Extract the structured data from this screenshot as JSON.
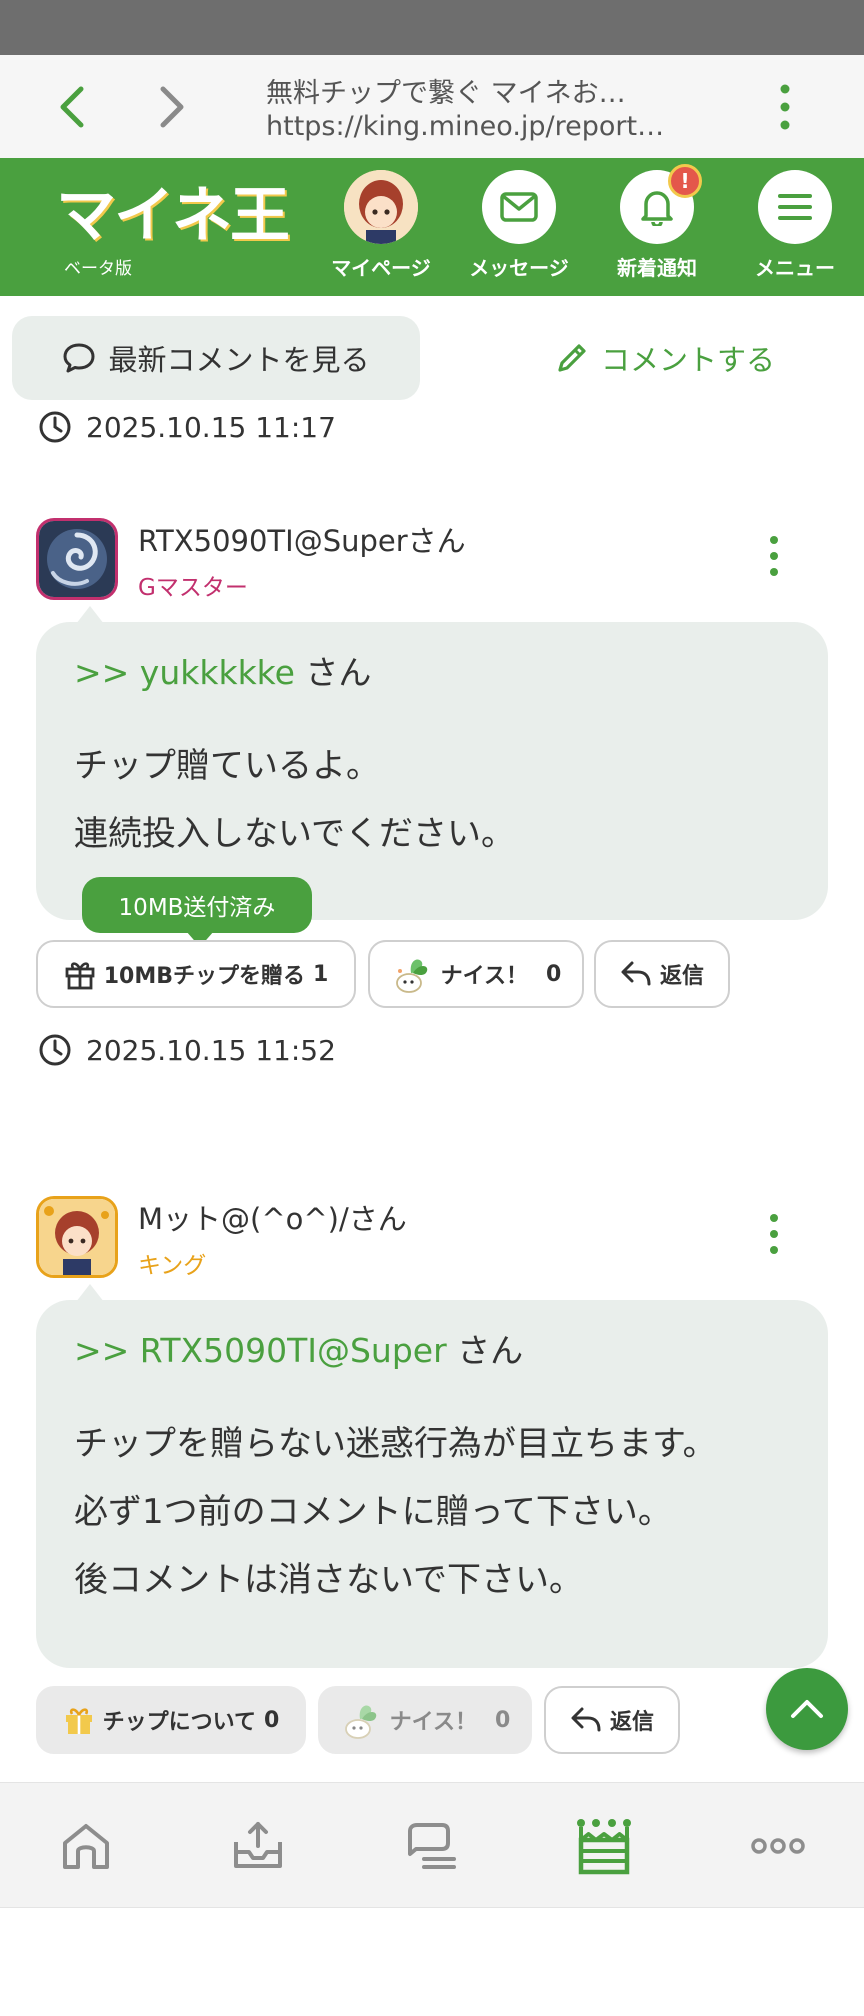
{
  "browser": {
    "page_title": "無料チップで繋ぐ マイネお…",
    "url": "https://king.mineo.jp/report…"
  },
  "header": {
    "logo_text": "マイネ王",
    "logo_sub": "ベータ版",
    "nav": [
      {
        "label": "マイページ",
        "icon": "avatar"
      },
      {
        "label": "メッセージ",
        "icon": "mail-icon"
      },
      {
        "label": "新着通知",
        "icon": "bell-icon",
        "badge": "!"
      },
      {
        "label": "メニュー",
        "icon": "hamburger-icon"
      }
    ]
  },
  "actions": {
    "latest_label": "最新コメントを見る",
    "comment_label": "コメントする"
  },
  "top_timestamp": "2025.10.15 11:17",
  "comments": [
    {
      "user": "RTX5090TI@Superさん",
      "rank": "Gマスター",
      "rank_color": "#c2306e",
      "reply_to": ">> yukkkkke",
      "reply_suffix": " さん",
      "lines": [
        "チップ贈ているよ。",
        "連続投入しないでください。"
      ],
      "tooltip": "10MB送付済み",
      "tip_label": "10MBチップを贈る",
      "tip_count": "1",
      "nice_label": "ナイス！",
      "nice_count": "0",
      "reply_label": "返信",
      "timestamp": "2025.10.15 11:52"
    },
    {
      "user": "Mット@(^o^)/さん",
      "rank": "キング",
      "rank_color": "#e8a21a",
      "reply_to": ">> RTX5090TI@Super",
      "reply_suffix": " さん",
      "lines": [
        "チップを贈らない迷惑行為が目立ちます。",
        "必ず1つ前のコメントに贈って下さい。",
        "後コメントは消さないで下さい。"
      ],
      "tip_label": "チップについて",
      "tip_count": "0",
      "nice_label": "ナイス！",
      "nice_count": "0",
      "reply_label": "返信"
    }
  ],
  "colors": {
    "brand_green": "#4aa03f",
    "bubble_bg": "#e9eeeb"
  }
}
